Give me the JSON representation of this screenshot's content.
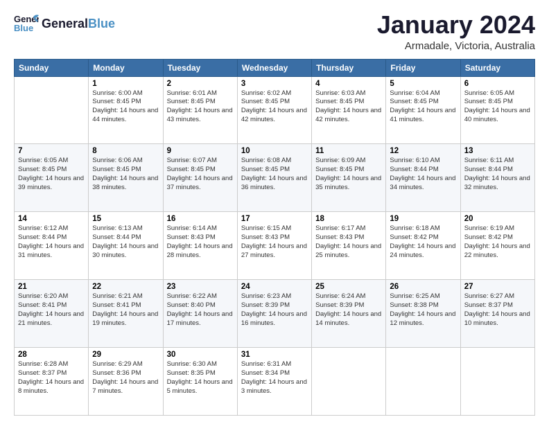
{
  "header": {
    "logo_general": "General",
    "logo_blue": "Blue",
    "month_title": "January 2024",
    "location": "Armadale, Victoria, Australia"
  },
  "calendar": {
    "days": [
      "Sunday",
      "Monday",
      "Tuesday",
      "Wednesday",
      "Thursday",
      "Friday",
      "Saturday"
    ],
    "weeks": [
      [
        {
          "date": "",
          "sunrise": "",
          "sunset": "",
          "daylight": ""
        },
        {
          "date": "1",
          "sunrise": "Sunrise: 6:00 AM",
          "sunset": "Sunset: 8:45 PM",
          "daylight": "Daylight: 14 hours and 44 minutes."
        },
        {
          "date": "2",
          "sunrise": "Sunrise: 6:01 AM",
          "sunset": "Sunset: 8:45 PM",
          "daylight": "Daylight: 14 hours and 43 minutes."
        },
        {
          "date": "3",
          "sunrise": "Sunrise: 6:02 AM",
          "sunset": "Sunset: 8:45 PM",
          "daylight": "Daylight: 14 hours and 42 minutes."
        },
        {
          "date": "4",
          "sunrise": "Sunrise: 6:03 AM",
          "sunset": "Sunset: 8:45 PM",
          "daylight": "Daylight: 14 hours and 42 minutes."
        },
        {
          "date": "5",
          "sunrise": "Sunrise: 6:04 AM",
          "sunset": "Sunset: 8:45 PM",
          "daylight": "Daylight: 14 hours and 41 minutes."
        },
        {
          "date": "6",
          "sunrise": "Sunrise: 6:05 AM",
          "sunset": "Sunset: 8:45 PM",
          "daylight": "Daylight: 14 hours and 40 minutes."
        }
      ],
      [
        {
          "date": "7",
          "sunrise": "Sunrise: 6:05 AM",
          "sunset": "Sunset: 8:45 PM",
          "daylight": "Daylight: 14 hours and 39 minutes."
        },
        {
          "date": "8",
          "sunrise": "Sunrise: 6:06 AM",
          "sunset": "Sunset: 8:45 PM",
          "daylight": "Daylight: 14 hours and 38 minutes."
        },
        {
          "date": "9",
          "sunrise": "Sunrise: 6:07 AM",
          "sunset": "Sunset: 8:45 PM",
          "daylight": "Daylight: 14 hours and 37 minutes."
        },
        {
          "date": "10",
          "sunrise": "Sunrise: 6:08 AM",
          "sunset": "Sunset: 8:45 PM",
          "daylight": "Daylight: 14 hours and 36 minutes."
        },
        {
          "date": "11",
          "sunrise": "Sunrise: 6:09 AM",
          "sunset": "Sunset: 8:45 PM",
          "daylight": "Daylight: 14 hours and 35 minutes."
        },
        {
          "date": "12",
          "sunrise": "Sunrise: 6:10 AM",
          "sunset": "Sunset: 8:44 PM",
          "daylight": "Daylight: 14 hours and 34 minutes."
        },
        {
          "date": "13",
          "sunrise": "Sunrise: 6:11 AM",
          "sunset": "Sunset: 8:44 PM",
          "daylight": "Daylight: 14 hours and 32 minutes."
        }
      ],
      [
        {
          "date": "14",
          "sunrise": "Sunrise: 6:12 AM",
          "sunset": "Sunset: 8:44 PM",
          "daylight": "Daylight: 14 hours and 31 minutes."
        },
        {
          "date": "15",
          "sunrise": "Sunrise: 6:13 AM",
          "sunset": "Sunset: 8:44 PM",
          "daylight": "Daylight: 14 hours and 30 minutes."
        },
        {
          "date": "16",
          "sunrise": "Sunrise: 6:14 AM",
          "sunset": "Sunset: 8:43 PM",
          "daylight": "Daylight: 14 hours and 28 minutes."
        },
        {
          "date": "17",
          "sunrise": "Sunrise: 6:15 AM",
          "sunset": "Sunset: 8:43 PM",
          "daylight": "Daylight: 14 hours and 27 minutes."
        },
        {
          "date": "18",
          "sunrise": "Sunrise: 6:17 AM",
          "sunset": "Sunset: 8:43 PM",
          "daylight": "Daylight: 14 hours and 25 minutes."
        },
        {
          "date": "19",
          "sunrise": "Sunrise: 6:18 AM",
          "sunset": "Sunset: 8:42 PM",
          "daylight": "Daylight: 14 hours and 24 minutes."
        },
        {
          "date": "20",
          "sunrise": "Sunrise: 6:19 AM",
          "sunset": "Sunset: 8:42 PM",
          "daylight": "Daylight: 14 hours and 22 minutes."
        }
      ],
      [
        {
          "date": "21",
          "sunrise": "Sunrise: 6:20 AM",
          "sunset": "Sunset: 8:41 PM",
          "daylight": "Daylight: 14 hours and 21 minutes."
        },
        {
          "date": "22",
          "sunrise": "Sunrise: 6:21 AM",
          "sunset": "Sunset: 8:41 PM",
          "daylight": "Daylight: 14 hours and 19 minutes."
        },
        {
          "date": "23",
          "sunrise": "Sunrise: 6:22 AM",
          "sunset": "Sunset: 8:40 PM",
          "daylight": "Daylight: 14 hours and 17 minutes."
        },
        {
          "date": "24",
          "sunrise": "Sunrise: 6:23 AM",
          "sunset": "Sunset: 8:39 PM",
          "daylight": "Daylight: 14 hours and 16 minutes."
        },
        {
          "date": "25",
          "sunrise": "Sunrise: 6:24 AM",
          "sunset": "Sunset: 8:39 PM",
          "daylight": "Daylight: 14 hours and 14 minutes."
        },
        {
          "date": "26",
          "sunrise": "Sunrise: 6:25 AM",
          "sunset": "Sunset: 8:38 PM",
          "daylight": "Daylight: 14 hours and 12 minutes."
        },
        {
          "date": "27",
          "sunrise": "Sunrise: 6:27 AM",
          "sunset": "Sunset: 8:37 PM",
          "daylight": "Daylight: 14 hours and 10 minutes."
        }
      ],
      [
        {
          "date": "28",
          "sunrise": "Sunrise: 6:28 AM",
          "sunset": "Sunset: 8:37 PM",
          "daylight": "Daylight: 14 hours and 8 minutes."
        },
        {
          "date": "29",
          "sunrise": "Sunrise: 6:29 AM",
          "sunset": "Sunset: 8:36 PM",
          "daylight": "Daylight: 14 hours and 7 minutes."
        },
        {
          "date": "30",
          "sunrise": "Sunrise: 6:30 AM",
          "sunset": "Sunset: 8:35 PM",
          "daylight": "Daylight: 14 hours and 5 minutes."
        },
        {
          "date": "31",
          "sunrise": "Sunrise: 6:31 AM",
          "sunset": "Sunset: 8:34 PM",
          "daylight": "Daylight: 14 hours and 3 minutes."
        },
        {
          "date": "",
          "sunrise": "",
          "sunset": "",
          "daylight": ""
        },
        {
          "date": "",
          "sunrise": "",
          "sunset": "",
          "daylight": ""
        },
        {
          "date": "",
          "sunrise": "",
          "sunset": "",
          "daylight": ""
        }
      ]
    ]
  }
}
